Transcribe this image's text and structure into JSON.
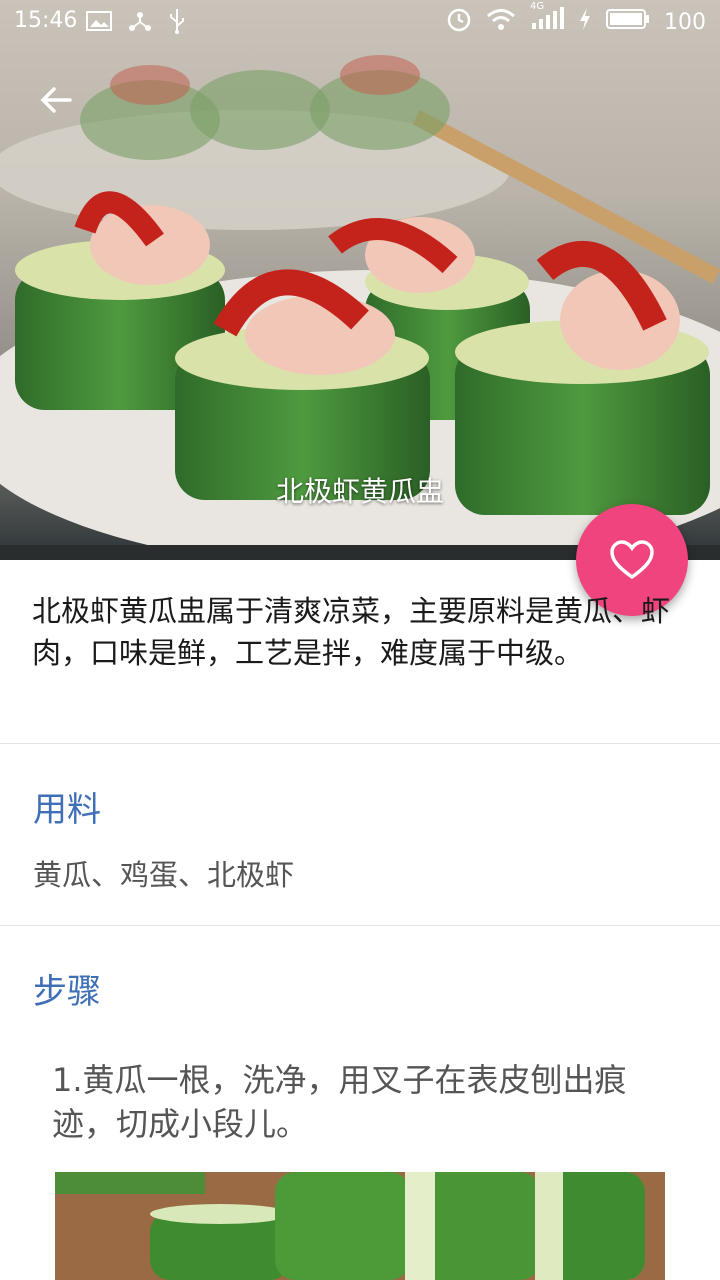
{
  "status_bar": {
    "time": "15:46",
    "battery": "100",
    "network": "4G",
    "left_icons": [
      "image-icon",
      "usb-share-icon",
      "usb-icon"
    ],
    "right_icons": [
      "alarm-icon",
      "wifi-icon",
      "signal-icon",
      "charging-icon",
      "battery-icon"
    ]
  },
  "hero": {
    "caption": "北极虾黄瓜盅"
  },
  "nav": {
    "back_icon": "arrow-left-icon"
  },
  "fab": {
    "icon": "heart-icon",
    "color": "#f0447e"
  },
  "description": "北极虾黄瓜盅属于清爽凉菜，主要原料是黄瓜、虾肉，口味是鲜，工艺是拌，难度属于中级。",
  "ingredients_section": {
    "title": "用料",
    "items": "黄瓜、鸡蛋、北极虾"
  },
  "steps_section": {
    "title": "步骤",
    "steps": [
      {
        "text": "1.黄瓜一根，洗净，用叉子在表皮刨出痕迹，切成小段儿。"
      }
    ]
  },
  "colors": {
    "section_title": "#3f6fb6",
    "body_text": "#1a1a1a",
    "muted_text": "#555555"
  }
}
